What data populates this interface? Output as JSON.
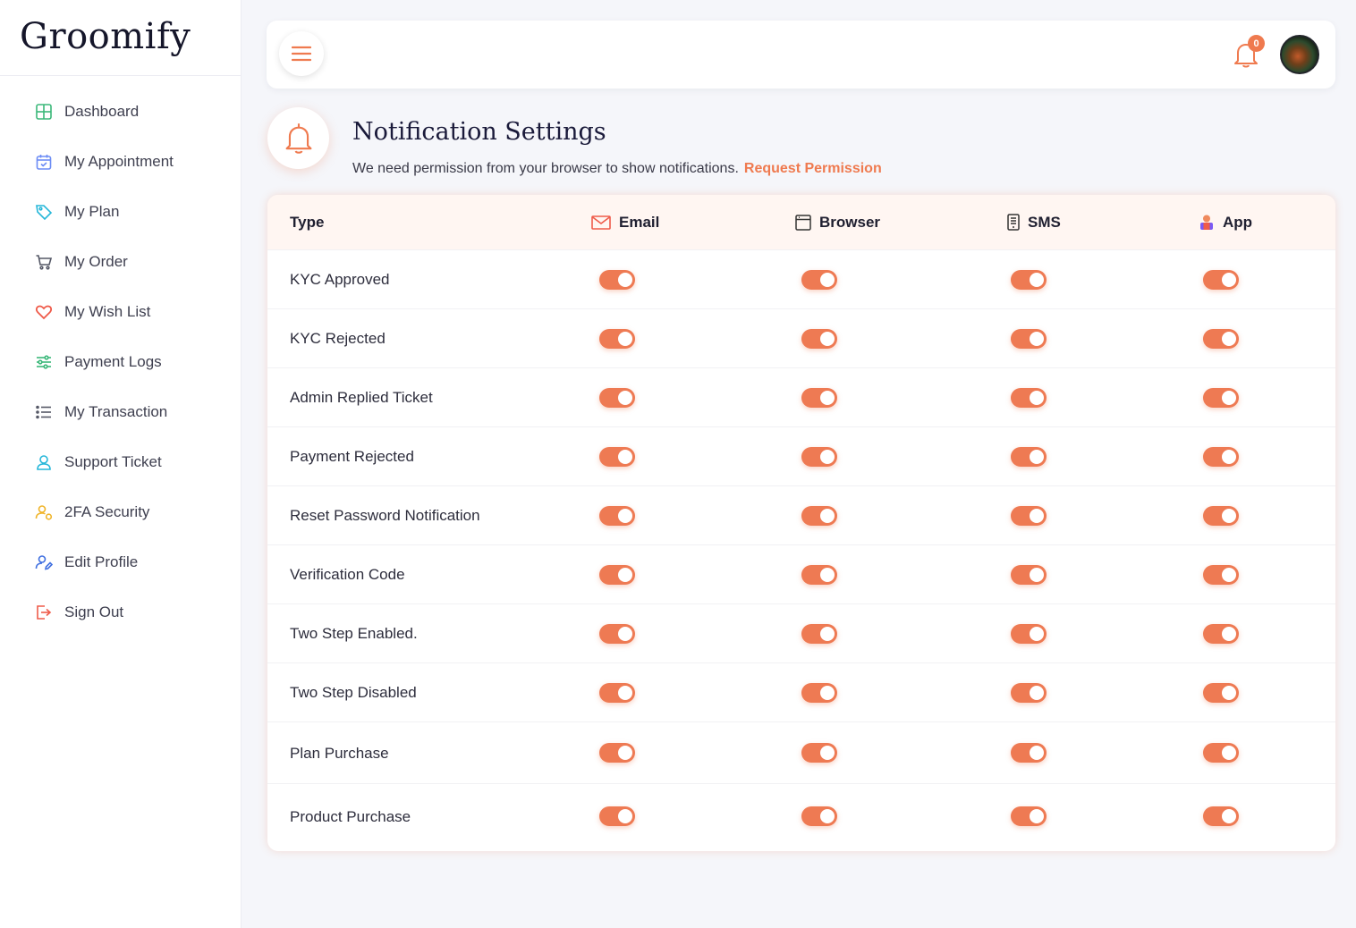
{
  "brand": {
    "name": "Groomify"
  },
  "sidebar": {
    "items": [
      {
        "label": "Dashboard",
        "icon": "grid-icon",
        "color": "#3bb87a"
      },
      {
        "label": "My Appointment",
        "icon": "calendar-icon",
        "color": "#6c8cf5"
      },
      {
        "label": "My Plan",
        "icon": "tag-icon",
        "color": "#26b7d9"
      },
      {
        "label": "My Order",
        "icon": "cart-icon",
        "color": "#555866"
      },
      {
        "label": "My Wish List",
        "icon": "heart-icon",
        "color": "#ef5b4a"
      },
      {
        "label": "Payment Logs",
        "icon": "sliders-icon",
        "color": "#3bb87a"
      },
      {
        "label": "My Transaction",
        "icon": "list-icon",
        "color": "#555866"
      },
      {
        "label": "Support Ticket",
        "icon": "support-icon",
        "color": "#26b7d9"
      },
      {
        "label": "2FA Security",
        "icon": "user-lock-icon",
        "color": "#f0b429"
      },
      {
        "label": "Edit Profile",
        "icon": "user-edit-icon",
        "color": "#3f6fe0"
      },
      {
        "label": "Sign Out",
        "icon": "signout-icon",
        "color": "#ef5b4a"
      }
    ]
  },
  "topbar": {
    "notification_count": "0"
  },
  "page": {
    "title": "Notification Settings",
    "permission_text": "We need permission from your browser to show notifications.",
    "permission_link": "Request Permission"
  },
  "table": {
    "type_header": "Type",
    "columns": [
      {
        "label": "Email",
        "icon": "mail-icon"
      },
      {
        "label": "Browser",
        "icon": "browser-icon"
      },
      {
        "label": "SMS",
        "icon": "phone-icon"
      },
      {
        "label": "App",
        "icon": "app-user-icon"
      }
    ],
    "rows": [
      {
        "label": "KYC Approved",
        "email": true,
        "browser": true,
        "sms": true,
        "app": true
      },
      {
        "label": "KYC Rejected",
        "email": true,
        "browser": true,
        "sms": true,
        "app": true
      },
      {
        "label": "Admin Replied Ticket",
        "email": true,
        "browser": true,
        "sms": true,
        "app": true
      },
      {
        "label": "Payment Rejected",
        "email": true,
        "browser": true,
        "sms": true,
        "app": true
      },
      {
        "label": "Reset Password Notification",
        "email": true,
        "browser": true,
        "sms": true,
        "app": true
      },
      {
        "label": "Verification Code",
        "email": true,
        "browser": true,
        "sms": true,
        "app": true
      },
      {
        "label": "Two Step Enabled.",
        "email": true,
        "browser": true,
        "sms": true,
        "app": true
      },
      {
        "label": "Two Step Disabled",
        "email": true,
        "browser": true,
        "sms": true,
        "app": true
      },
      {
        "label": "Plan Purchase",
        "email": true,
        "browser": true,
        "sms": true,
        "app": true
      },
      {
        "label": "Product Purchase",
        "email": true,
        "browser": true,
        "sms": true,
        "app": true
      }
    ]
  },
  "colors": {
    "accent": "#ef7a4f",
    "toggle_on": "#ee7a53"
  }
}
